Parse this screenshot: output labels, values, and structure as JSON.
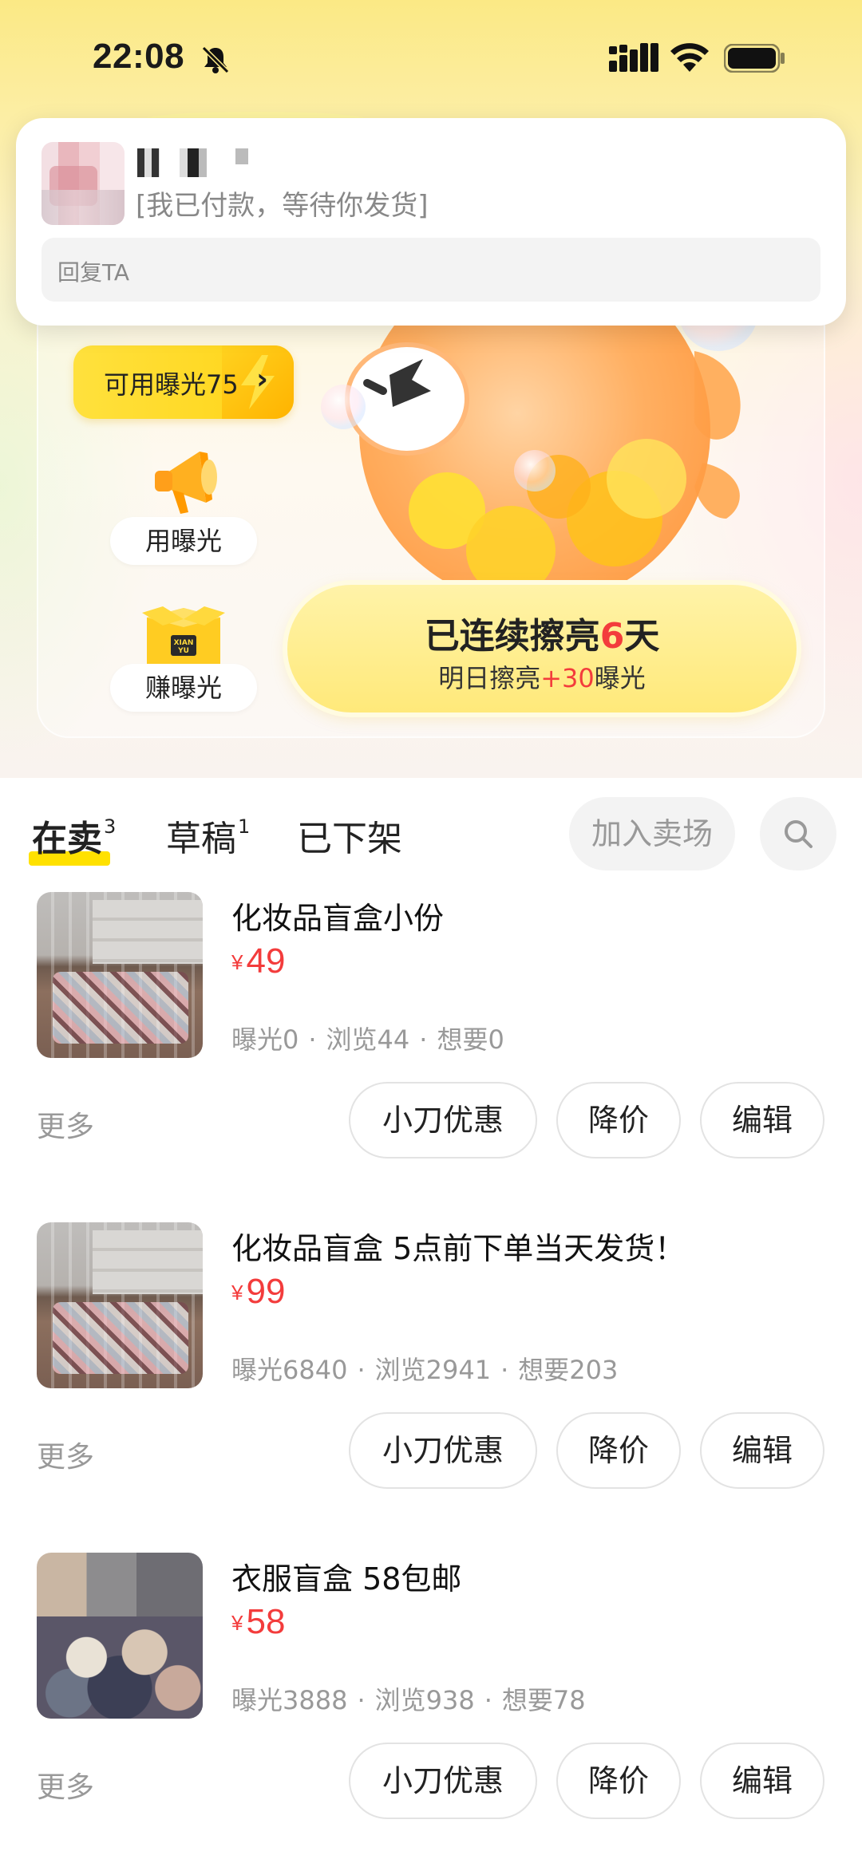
{
  "status_bar": {
    "time": "22:08",
    "icons": [
      "bell-off-icon",
      "signal-icon",
      "wifi-icon",
      "battery-icon"
    ]
  },
  "notification": {
    "message": "[我已付款，等待你发货]",
    "reply_placeholder": "回复TA"
  },
  "exposure": {
    "label": "可用曝光75",
    "chevron": "›"
  },
  "actions": {
    "use_exposure": "用曝光",
    "earn_exposure": "赚曝光"
  },
  "streak": {
    "prefix": "已连续擦亮",
    "days": "6",
    "suffix": "天",
    "sub_prefix": "明日擦亮",
    "sub_bonus": "+30",
    "sub_suffix": "曝光"
  },
  "tabs": [
    {
      "label": "在卖",
      "count": "3",
      "active": true
    },
    {
      "label": "草稿",
      "count": "1",
      "active": false
    },
    {
      "label": "已下架",
      "count": "",
      "active": false
    }
  ],
  "join_market_label": "加入卖场",
  "listings": [
    {
      "title": "化妆品盲盒小份",
      "currency": "¥",
      "price": "49",
      "exposure": "曝光0",
      "views": "浏览44",
      "wants": "想要0",
      "more": "更多",
      "btn_discount": "小刀优惠",
      "btn_reduce": "降价",
      "btn_edit": "编辑"
    },
    {
      "title": "化妆品盲盒 5点前下单当天发货！",
      "currency": "¥",
      "price": "99",
      "exposure": "曝光6840",
      "views": "浏览2941",
      "wants": "想要203",
      "more": "更多",
      "btn_discount": "小刀优惠",
      "btn_reduce": "降价",
      "btn_edit": "编辑"
    },
    {
      "title": "衣服盲盒 58包邮",
      "currency": "¥",
      "price": "58",
      "exposure": "曝光3888",
      "views": "浏览938",
      "wants": "想要78",
      "more": "更多",
      "btn_discount": "小刀优惠",
      "btn_reduce": "降价",
      "btn_edit": "编辑"
    }
  ],
  "colors": {
    "accent_yellow": "#ffe100",
    "price_red": "#f33c3c",
    "muted_gray": "#999999"
  }
}
